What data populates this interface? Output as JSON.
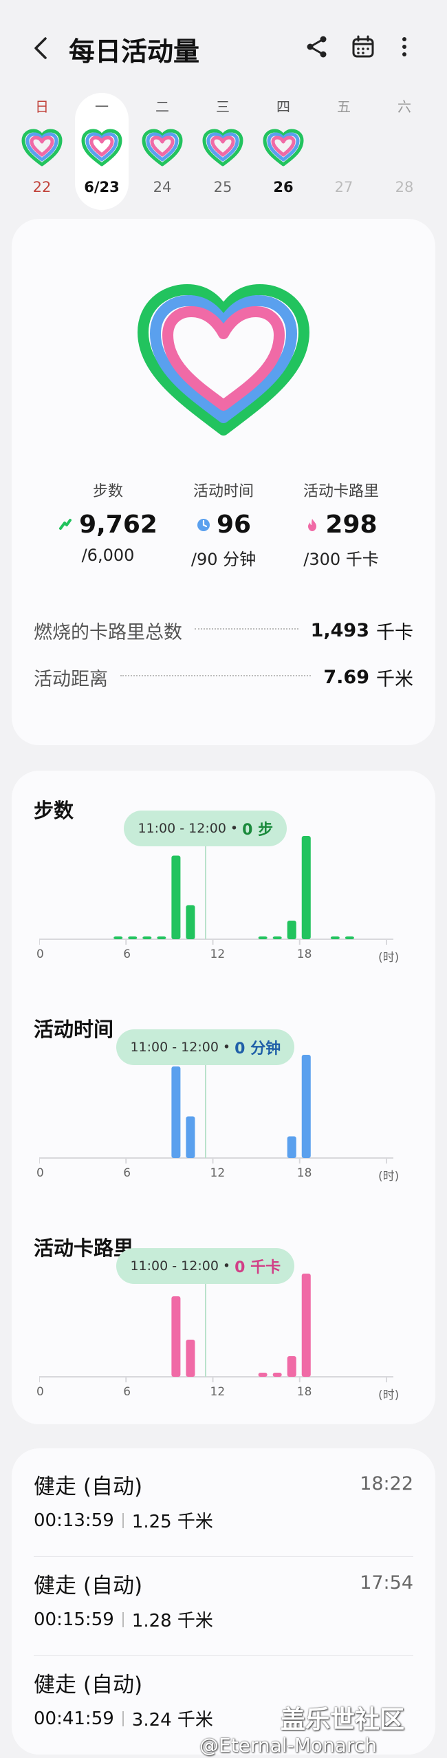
{
  "header": {
    "title": "每日活动量"
  },
  "week": [
    {
      "dow": "日",
      "num": "22",
      "style": "sun"
    },
    {
      "dow": "一",
      "num": "6/23",
      "style": "selected"
    },
    {
      "dow": "二",
      "num": "24",
      "style": ""
    },
    {
      "dow": "三",
      "num": "25",
      "style": ""
    },
    {
      "dow": "四",
      "num": "26",
      "style": "bold"
    },
    {
      "dow": "五",
      "num": "27",
      "style": "faded"
    },
    {
      "dow": "六",
      "num": "28",
      "style": "faded"
    }
  ],
  "summary": {
    "steps": {
      "label": "步数",
      "value": "9,762",
      "goal": "/6,000"
    },
    "active_time": {
      "label": "活动时间",
      "value": "96",
      "goal": "/90 分钟"
    },
    "active_cal": {
      "label": "活动卡路里",
      "value": "298",
      "goal": "/300 千卡"
    },
    "total_burned": {
      "label": "燃烧的卡路里总数",
      "value": "1,493",
      "unit": "千卡"
    },
    "distance": {
      "label": "活动距离",
      "value": "7.69",
      "unit": "千米"
    }
  },
  "colors": {
    "steps": "#22c35e",
    "time": "#5aa0ee",
    "calories": "#f06aa6",
    "tooltip_bg": "#c7ecd8"
  },
  "chart_data": [
    {
      "type": "bar",
      "title": "步数",
      "x_ticks": [
        "0",
        "6",
        "12",
        "18",
        "(时)"
      ],
      "tooltip": {
        "range": "11:00 - 12:00",
        "value": "0 步"
      },
      "hours": [
        0,
        1,
        2,
        3,
        4,
        5,
        6,
        7,
        8,
        9,
        10,
        11,
        12,
        13,
        14,
        15,
        16,
        17,
        18,
        19,
        20,
        21,
        22,
        23
      ],
      "values": [
        0,
        0,
        0,
        0,
        0,
        20,
        20,
        20,
        20,
        810,
        330,
        0,
        0,
        0,
        0,
        20,
        20,
        180,
        1000,
        0,
        20,
        20,
        0,
        0
      ]
    },
    {
      "type": "bar",
      "title": "活动时间",
      "x_ticks": [
        "0",
        "6",
        "12",
        "18",
        "(时)"
      ],
      "tooltip": {
        "range": "11:00 - 12:00",
        "value": "0 分钟"
      },
      "hours": [
        0,
        1,
        2,
        3,
        4,
        5,
        6,
        7,
        8,
        9,
        10,
        11,
        12,
        13,
        14,
        15,
        16,
        17,
        18,
        19,
        20,
        21,
        22,
        23
      ],
      "values": [
        0,
        0,
        0,
        0,
        0,
        0,
        0,
        0,
        0,
        55,
        25,
        0,
        0,
        0,
        0,
        0,
        0,
        13,
        62,
        0,
        0,
        0,
        0,
        0
      ]
    },
    {
      "type": "bar",
      "title": "活动卡路里",
      "x_ticks": [
        "0",
        "6",
        "12",
        "18",
        "(时)"
      ],
      "tooltip": {
        "range": "11:00 - 12:00",
        "value": "0 千卡"
      },
      "hours": [
        0,
        1,
        2,
        3,
        4,
        5,
        6,
        7,
        8,
        9,
        10,
        11,
        12,
        13,
        14,
        15,
        16,
        17,
        18,
        19,
        20,
        21,
        22,
        23
      ],
      "values": [
        0,
        0,
        0,
        0,
        0,
        0,
        0,
        0,
        0,
        78,
        36,
        0,
        0,
        0,
        0,
        4,
        4,
        20,
        100,
        0,
        0,
        0,
        0,
        0
      ]
    }
  ],
  "workouts": [
    {
      "name": "健走 (自动)",
      "time": "18:22",
      "duration": "00:13:59",
      "distance": "1.25 千米"
    },
    {
      "name": "健走 (自动)",
      "time": "17:54",
      "duration": "00:15:59",
      "distance": "1.28 千米"
    },
    {
      "name": "健走 (自动)",
      "time": "",
      "duration": "00:41:59",
      "distance": "3.24 千米"
    }
  ],
  "watermark": {
    "line1": "盖乐世社区",
    "line2": "@Eternal-Monarch"
  }
}
